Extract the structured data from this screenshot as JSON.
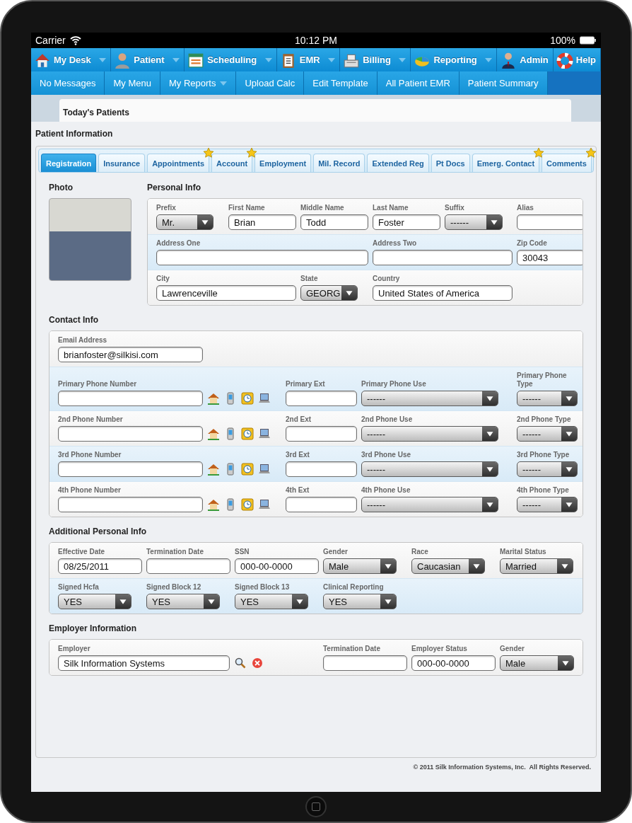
{
  "status_bar": {
    "carrier": "Carrier",
    "time": "10:12 PM",
    "battery": "100%"
  },
  "main_menu": [
    {
      "label": "My Desk",
      "has_menu": true
    },
    {
      "label": "Patient",
      "has_menu": true
    },
    {
      "label": "Scheduling",
      "has_menu": true
    },
    {
      "label": "EMR",
      "has_menu": true
    },
    {
      "label": "Billing",
      "has_menu": true
    },
    {
      "label": "Reporting",
      "has_menu": true
    },
    {
      "label": "Admin",
      "has_menu": false
    },
    {
      "label": "Help",
      "has_menu": false
    }
  ],
  "sub_menu": [
    {
      "label": "No Messages",
      "has_menu": false
    },
    {
      "label": "My Menu",
      "has_menu": false
    },
    {
      "label": "My Reports",
      "has_menu": true
    },
    {
      "label": "Upload Calc",
      "has_menu": false
    },
    {
      "label": "Edit Template",
      "has_menu": false
    },
    {
      "label": "All Patient EMR",
      "has_menu": false
    },
    {
      "label": "Patient Summary",
      "has_menu": false
    }
  ],
  "todays_patients": "Today's Patients",
  "page_title": "Patient Information",
  "tabs": [
    {
      "label": "Registration",
      "selected": true,
      "starred": false
    },
    {
      "label": "Insurance",
      "selected": false,
      "starred": false
    },
    {
      "label": "Appointments",
      "selected": false,
      "starred": true
    },
    {
      "label": "Account",
      "selected": false,
      "starred": true
    },
    {
      "label": "Employment",
      "selected": false,
      "starred": false
    },
    {
      "label": "Mil. Record",
      "selected": false,
      "starred": false
    },
    {
      "label": "Extended Reg",
      "selected": false,
      "starred": false
    },
    {
      "label": "Pt Docs",
      "selected": false,
      "starred": false
    },
    {
      "label": "Emerg. Contact",
      "selected": false,
      "starred": true
    },
    {
      "label": "Comments",
      "selected": false,
      "starred": true
    }
  ],
  "photo": {
    "label": "Photo"
  },
  "personal_info": {
    "title": "Personal Info",
    "rows": [
      [
        {
          "kind": "select",
          "label": "Prefix",
          "value": "Mr."
        },
        {
          "kind": "text",
          "label": "First Name",
          "value": "Brian"
        },
        {
          "kind": "text",
          "label": "Middle Name",
          "value": "Todd"
        },
        {
          "kind": "text",
          "label": "Last Name",
          "value": "Foster"
        },
        {
          "kind": "select",
          "label": "Suffix",
          "value": "------"
        },
        {
          "kind": "text",
          "label": "Alias"
        }
      ],
      [
        {
          "kind": "text",
          "label": "Address One"
        },
        "",
        "",
        {
          "kind": "text",
          "label": "Address Two"
        },
        "",
        {
          "kind": "text",
          "label": "Zip Code",
          "value": "30043"
        }
      ],
      [
        {
          "kind": "text",
          "label": "City",
          "value": "Lawrenceville"
        },
        "",
        {
          "kind": "select",
          "label": "State",
          "value": "GEORG"
        },
        {
          "kind": "text",
          "label": "Country",
          "value": "United States of America"
        },
        ""
      ]
    ]
  },
  "sections": [
    {
      "title": "Contact Info",
      "rows": [
        [
          {
            "kind": "text",
            "label": "Email Address",
            "value": "brianfoster@silkisi.com"
          }
        ],
        [
          {
            "kind": "phone",
            "label": "Primary Phone Number"
          },
          "",
          {
            "kind": "text",
            "label": "Primary Ext"
          },
          {
            "kind": "select",
            "label": "Primary Phone Use",
            "value": "------"
          },
          {
            "kind": "select",
            "label": "Primary Phone Type",
            "value": "------"
          }
        ],
        [
          {
            "kind": "phone",
            "label": "2nd Phone Number"
          },
          "",
          {
            "kind": "text",
            "label": "2nd Ext"
          },
          {
            "kind": "select",
            "label": "2nd Phone Use",
            "value": "------"
          },
          {
            "kind": "select",
            "label": "2nd Phone Type",
            "value": "------"
          }
        ],
        [
          {
            "kind": "phone",
            "label": "3rd Phone Number"
          },
          "",
          {
            "kind": "text",
            "label": "3rd Ext"
          },
          {
            "kind": "select",
            "label": "3rd Phone Use",
            "value": "------"
          },
          {
            "kind": "select",
            "label": "3rd Phone Type",
            "value": "------"
          }
        ],
        [
          {
            "kind": "phone",
            "label": "4th Phone Number"
          },
          "",
          {
            "kind": "text",
            "label": "4th Ext"
          },
          {
            "kind": "select",
            "label": "4th Phone Use",
            "value": "------"
          },
          {
            "kind": "select",
            "label": "4th Phone Type",
            "value": "------"
          }
        ]
      ]
    },
    {
      "title": "Additional Personal Info",
      "rows": [
        [
          {
            "kind": "text",
            "label": "Effective Date",
            "value": "08/25/2011"
          },
          {
            "kind": "text",
            "label": "Termination Date"
          },
          {
            "kind": "text",
            "label": "SSN",
            "value": "000-00-0000"
          },
          {
            "kind": "select",
            "label": "Gender",
            "value": "Male"
          },
          {
            "kind": "select",
            "label": "Race",
            "value": "Caucasian"
          },
          {
            "kind": "select",
            "label": "Marital Status",
            "value": "Married"
          }
        ],
        [
          {
            "kind": "select",
            "label": "Signed Hcfa",
            "value": "YES"
          },
          {
            "kind": "select",
            "label": "Signed Block 12",
            "value": "YES"
          },
          {
            "kind": "select",
            "label": "Signed Block 13",
            "value": "YES"
          },
          {
            "kind": "select",
            "label": "Clinical Reporting",
            "value": "YES"
          }
        ]
      ]
    },
    {
      "title": "Employer Information",
      "rows": [
        [
          {
            "kind": "lookup",
            "label": "Employer",
            "value": "Silk Information Systems"
          },
          "",
          "",
          {
            "kind": "text",
            "label": "Termination Date"
          },
          {
            "kind": "text",
            "label": "Employer Status",
            "value": "000-00-0000"
          },
          {
            "kind": "select",
            "label": "Gender",
            "value": "Male"
          }
        ]
      ]
    }
  ],
  "footer": "© 2011 Silk Information Systems, Inc.  All Rights Reserved."
}
